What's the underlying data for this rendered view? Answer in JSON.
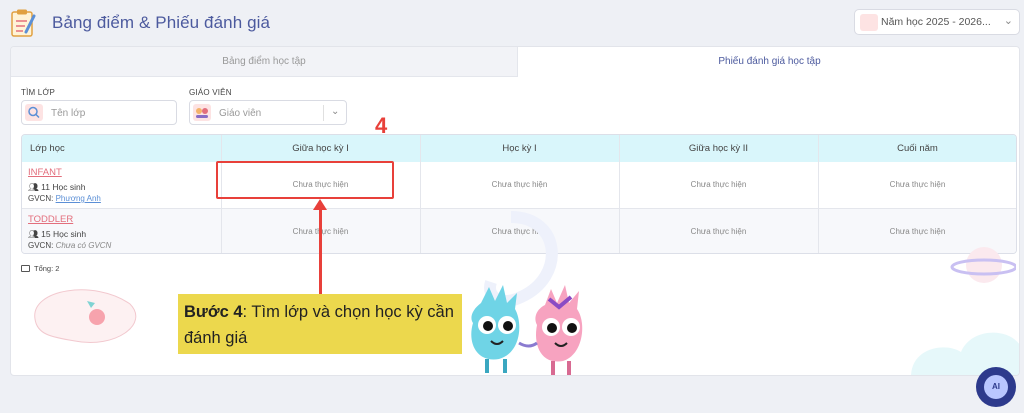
{
  "header": {
    "title": "Bảng điểm & Phiếu đánh giá",
    "year_select": "Năm học 2025 - 2026..."
  },
  "tabs": [
    {
      "label": "Bảng điểm học tập",
      "active": false
    },
    {
      "label": "Phiếu đánh giá học tập",
      "active": true
    }
  ],
  "filters": {
    "class": {
      "label": "TÌM LỚP",
      "placeholder": "Tên lớp"
    },
    "teacher": {
      "label": "GIÁO VIÊN",
      "placeholder": "Giáo viên"
    }
  },
  "table": {
    "headers": [
      "Lớp học",
      "Giữa học kỳ I",
      "Học kỳ I",
      "Giữa học kỳ II",
      "Cuối năm"
    ],
    "rows": [
      {
        "name": "INFANT",
        "count": "11 Học sinh",
        "teacher_prefix": "GVCN:",
        "teacher": "Phương Anh",
        "cells": [
          "Chưa thực hiện",
          "Chưa thực hiện",
          "Chưa thực hiện",
          "Chưa thực hiện"
        ]
      },
      {
        "name": "TODDLER",
        "count": "15 Học sinh",
        "teacher_prefix": "GVCN:",
        "teacher": "Chưa có GVCN",
        "cells": [
          "Chưa thực hiện",
          "Chưa thực hiện",
          "Chưa thực hiện",
          "Chưa thực hiện"
        ]
      }
    ]
  },
  "total": "Tổng: 2",
  "annotation": {
    "step_number": "4",
    "callout_bold": "Bước 4",
    "callout_text": ": Tìm lớp và chọn học kỳ cần đánh giá"
  },
  "ai_button": "AI",
  "colors": {
    "accent": "#4c5a9e",
    "header_row": "#d9f6fb",
    "highlight": "#e8403a",
    "callout": "#ecd84d",
    "class_link": "#e36e7c"
  }
}
